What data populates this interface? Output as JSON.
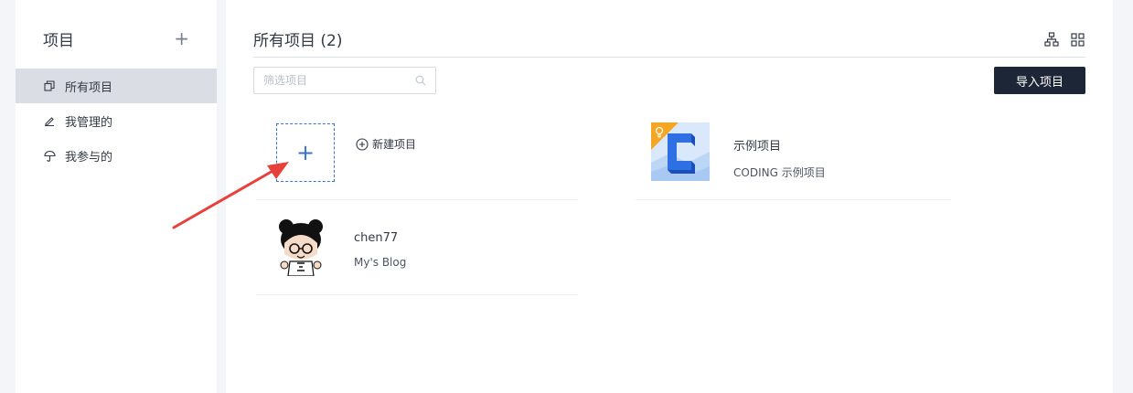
{
  "sidebar": {
    "title": "项目",
    "add_icon": "plus-icon",
    "items": [
      {
        "label": "所有项目",
        "icon": "copy-icon",
        "active": true
      },
      {
        "label": "我管理的",
        "icon": "pencil-icon",
        "active": false
      },
      {
        "label": "我参与的",
        "icon": "umbrella-icon",
        "active": false
      }
    ]
  },
  "main": {
    "title": "所有项目 (2)",
    "view_icons": [
      "tree-view-icon",
      "grid-view-icon"
    ],
    "search": {
      "placeholder": "筛选项目",
      "value": ""
    },
    "import_label": "导入项目",
    "new_project": {
      "plus": "+",
      "label": "新建项目"
    },
    "projects": [
      {
        "name": "示例项目",
        "desc": "CODING 示例项目",
        "thumb": "coding-logo"
      },
      {
        "name": "chen77",
        "desc": "My's Blog",
        "thumb": "panda-avatar"
      }
    ]
  },
  "colors": {
    "accent": "#3974cc",
    "dark_button": "#1d2636",
    "arrow": "#e8413c",
    "active_bg": "#dadde4"
  }
}
